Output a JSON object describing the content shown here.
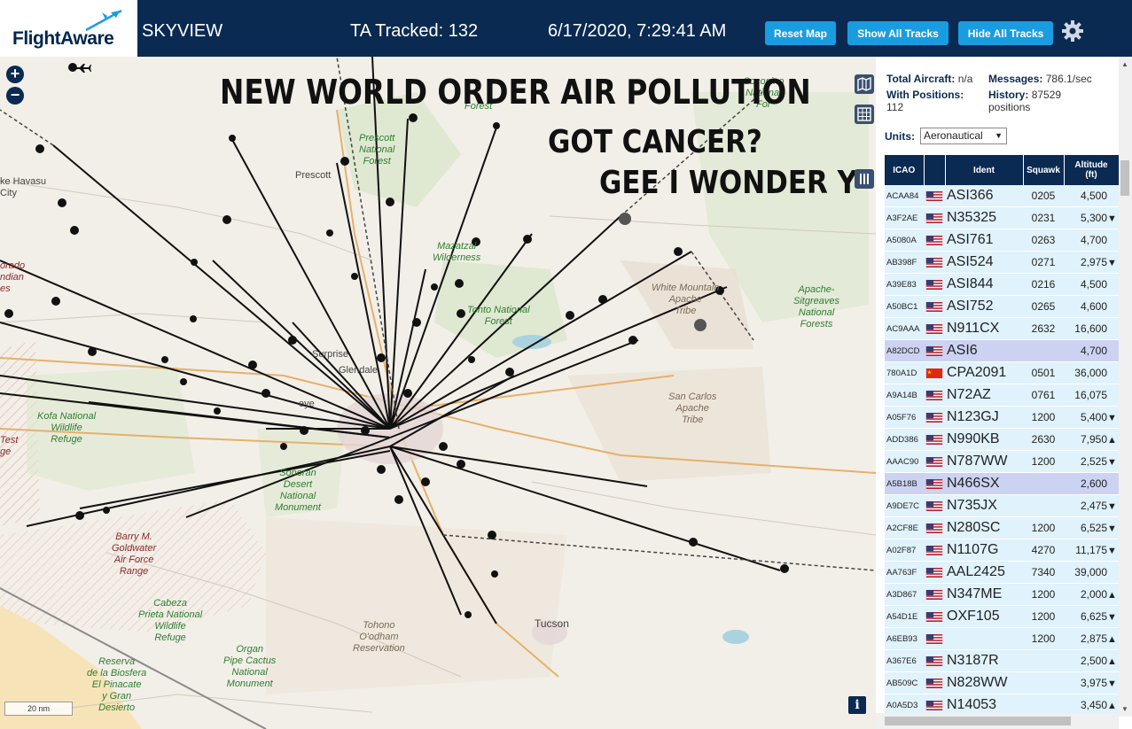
{
  "header": {
    "logo": "FlightAware",
    "app_name": "SKYVIEW",
    "tracked": "TA Tracked: 132",
    "datetime": "6/17/2020, 7:29:41 AM",
    "reset_label": "Reset Map",
    "show_tracks_label": "Show All Tracks",
    "hide_tracks_label": "Hide All Tracks"
  },
  "overlay": {
    "line1": "NEW WORLD ORDER AIR POLLUTION",
    "line2": "GOT CANCER?",
    "line3": "GEE I WONDER Y"
  },
  "map": {
    "scale": "20 nm",
    "labels": {
      "prescott_nf": "Prescott\nNational\nForest",
      "prescott": "Prescott",
      "lake_havasu": "ke Havasu\nCity",
      "surprise": "Surprise",
      "glendale": "Glendale",
      "tonto": "Tonto National\nForest",
      "white_mountain": "White Mountain\nApache\nTribe",
      "apache_sitgreaves": "Apache-\nSitgreaves\nNational\nForests",
      "san_carlos": "San Carlos\nApache\nTribe",
      "kofa": "Kofa National\nWildlife\nRefuge",
      "barry": "Barry M.\nGoldwater\nAir Force\nRange",
      "cabeza": "Cabeza\nPrieta National\nWildlife\nRefuge",
      "tohono": "Tohono\nO'odham\nReservation",
      "organ": "Organ\nPipe Cactus\nNational\nMonument",
      "tucson": "Tucson",
      "reserva": "Reserva\nde la Biosfera\nEl Pinacate\ny Gran\nDesierto",
      "sonoran": "Sonoran\nDesert\nNational\nMonument",
      "test": "Test\nge",
      "mazatzal": "Mazatzal\nWilderness",
      "forest_top": "Forest",
      "coconino": "Coconino\nNational\nFor",
      "orado": "orado\nndian\nes",
      "eye": "eye"
    }
  },
  "panel": {
    "total_label": "Total Aircraft:",
    "total_value": "n/a",
    "messages_label": "Messages:",
    "messages_value": "786.1/sec",
    "positions_label": "With Positions:",
    "positions_value": "112",
    "history_label": "History:",
    "history_value": "87529",
    "history_unit": "positions",
    "units_label": "Units:",
    "units_value": "Aeronautical",
    "columns": [
      "ICAO",
      "Ident",
      "Squawk",
      "Altitude\n(ft)"
    ],
    "rows": [
      {
        "icao": "ACAA84",
        "flag": "us",
        "ident": "ASI366",
        "squawk": "0205",
        "alt": "4,500",
        "trend": ""
      },
      {
        "icao": "A3F2AE",
        "flag": "us",
        "ident": "N35325",
        "squawk": "0231",
        "alt": "5,300",
        "trend": "▼"
      },
      {
        "icao": "A5080A",
        "flag": "us",
        "ident": "ASI761",
        "squawk": "0263",
        "alt": "4,700",
        "trend": ""
      },
      {
        "icao": "AB398F",
        "flag": "us",
        "ident": "ASI524",
        "squawk": "0271",
        "alt": "2,975",
        "trend": "▼"
      },
      {
        "icao": "A39E83",
        "flag": "us",
        "ident": "ASI844",
        "squawk": "0216",
        "alt": "4,500",
        "trend": ""
      },
      {
        "icao": "A50BC1",
        "flag": "us",
        "ident": "ASI752",
        "squawk": "0265",
        "alt": "4,600",
        "trend": ""
      },
      {
        "icao": "AC9AAA",
        "flag": "us",
        "ident": "N911CX",
        "squawk": "2632",
        "alt": "16,600",
        "trend": ""
      },
      {
        "icao": "A82DCD",
        "flag": "us",
        "ident": "ASI6",
        "squawk": "",
        "alt": "4,700",
        "trend": "",
        "sel": true
      },
      {
        "icao": "780A1D",
        "flag": "cn",
        "ident": "CPA2091",
        "squawk": "0501",
        "alt": "36,000",
        "trend": ""
      },
      {
        "icao": "A9A14B",
        "flag": "us",
        "ident": "N72AZ",
        "squawk": "0761",
        "alt": "16,075",
        "trend": ""
      },
      {
        "icao": "A05F76",
        "flag": "us",
        "ident": "N123GJ",
        "squawk": "1200",
        "alt": "5,400",
        "trend": "▼"
      },
      {
        "icao": "ADD386",
        "flag": "us",
        "ident": "N990KB",
        "squawk": "2630",
        "alt": "7,950",
        "trend": "▲"
      },
      {
        "icao": "AAAC90",
        "flag": "us",
        "ident": "N787WW",
        "squawk": "1200",
        "alt": "2,525",
        "trend": "▼"
      },
      {
        "icao": "A5B18B",
        "flag": "us",
        "ident": "N466SX",
        "squawk": "",
        "alt": "2,600",
        "trend": "",
        "sel": true
      },
      {
        "icao": "A9DE7C",
        "flag": "us",
        "ident": "N735JX",
        "squawk": "",
        "alt": "2,475",
        "trend": "▼"
      },
      {
        "icao": "A2CF8E",
        "flag": "us",
        "ident": "N280SC",
        "squawk": "1200",
        "alt": "6,525",
        "trend": "▼"
      },
      {
        "icao": "A02F87",
        "flag": "us",
        "ident": "N1107G",
        "squawk": "4270",
        "alt": "11,175",
        "trend": "▼"
      },
      {
        "icao": "AA763F",
        "flag": "us",
        "ident": "AAL2425",
        "squawk": "7340",
        "alt": "39,000",
        "trend": ""
      },
      {
        "icao": "A3D867",
        "flag": "us",
        "ident": "N347ME",
        "squawk": "1200",
        "alt": "2,000",
        "trend": "▲"
      },
      {
        "icao": "A54D1E",
        "flag": "us",
        "ident": "OXF105",
        "squawk": "1200",
        "alt": "6,625",
        "trend": "▼"
      },
      {
        "icao": "A6EB93",
        "flag": "us",
        "ident": "",
        "squawk": "1200",
        "alt": "2,875",
        "trend": "▲"
      },
      {
        "icao": "A367E6",
        "flag": "us",
        "ident": "N3187R",
        "squawk": "",
        "alt": "2,500",
        "trend": "▲"
      },
      {
        "icao": "AB509C",
        "flag": "us",
        "ident": "N828WW",
        "squawk": "",
        "alt": "3,975",
        "trend": "▼"
      },
      {
        "icao": "A0A5D3",
        "flag": "us",
        "ident": "N14053",
        "squawk": "",
        "alt": "3,450",
        "trend": "▲"
      }
    ]
  },
  "colors": {
    "header_bg": "#0a2a52",
    "button_bg": "#1a9de0",
    "row_bg": "#e0f2fb",
    "row_selected_bg": "#ccd3f2"
  }
}
